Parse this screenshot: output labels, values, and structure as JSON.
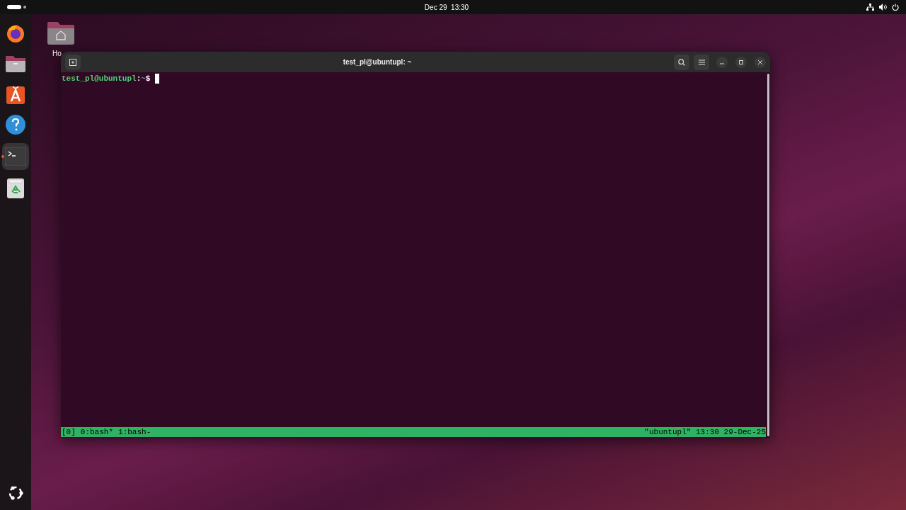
{
  "top_bar": {
    "clock": "Dec 29  13:30"
  },
  "dock": [
    {
      "kind": "firefox",
      "running": false
    },
    {
      "kind": "files",
      "running": false
    },
    {
      "kind": "appcenter",
      "running": false
    },
    {
      "kind": "help",
      "running": false
    },
    {
      "kind": "terminal",
      "running": true
    },
    {
      "kind": "trash",
      "running": false
    }
  ],
  "desktop_icons": [
    {
      "label": "Ho"
    }
  ],
  "terminal": {
    "title": "test_pl@ubuntupl: ~",
    "prompt": {
      "user_host": "test_pl@ubuntupl",
      "separator": ":",
      "path": "~",
      "symbol": "$"
    },
    "tmux": {
      "session": "[0]",
      "windows": [
        {
          "label": "0:bash*"
        },
        {
          "label": "1:bash-"
        }
      ],
      "right": "\"ubuntupl\" 13:30 29-Dec-25"
    }
  }
}
